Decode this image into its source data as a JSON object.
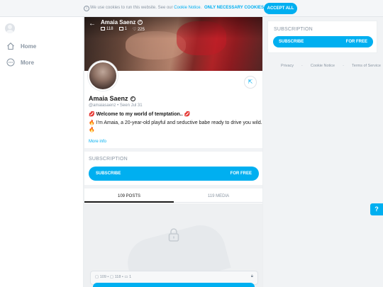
{
  "cookie_bar": {
    "message": "We use cookies to run this website. See our",
    "link": "Cookie Notice",
    "link_suffix": ".",
    "necessary_label": "ONLY NECESSARY COOKIES",
    "accept_label": "ACCEPT ALL"
  },
  "sidebar": {
    "items": [
      {
        "label": "Home",
        "icon": "home-icon"
      },
      {
        "label": "More",
        "icon": "more-icon"
      }
    ]
  },
  "cover": {
    "name": "Amaia Saenz",
    "stats": [
      {
        "icon": "image-icon",
        "value": "118"
      },
      {
        "icon": "video-icon",
        "value": "1"
      },
      {
        "icon": "heart-icon",
        "value": "225"
      }
    ]
  },
  "profile": {
    "name": "Amaia Saenz",
    "handle": "@amaiasaenz",
    "separator": "•",
    "seen": "Seen  Jul 31",
    "bio_line1": "💋 Welcome to my world of temptation.. 💋",
    "bio_line2": "🔥 I'm Amaia, a 20-year-old playful and seductive babe ready to drive you wild.",
    "bio_line3": "🔥",
    "more_info": "More info"
  },
  "subscription": {
    "title": "SUBSCRIPTION",
    "button_left": "SUBSCRIBE",
    "button_right": "FOR FREE"
  },
  "tabs": [
    {
      "label": "109 POSTS",
      "active": true
    },
    {
      "label": "119 MEDIA",
      "active": false
    }
  ],
  "locked_post": {
    "counts": "▢ 109 • ▢ 118 • ▭ 1"
  },
  "right_sidebar": {
    "title": "SUBSCRIPTION",
    "button_left": "SUBSCRIBE",
    "button_right": "FOR FREE"
  },
  "footer": {
    "links": [
      "Privacy",
      "Cookie Notice",
      "Terms of Service"
    ]
  },
  "colors": {
    "accent": "#00aff0",
    "muted": "#8a96a3"
  }
}
